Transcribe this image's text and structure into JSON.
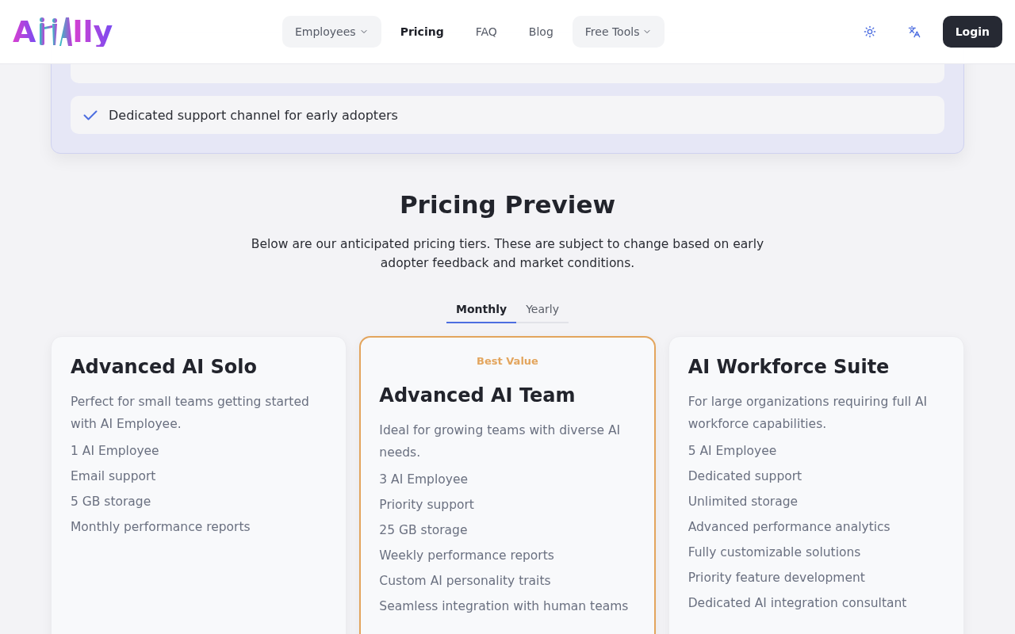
{
  "logo": {
    "lead": "A",
    "tail": "lly"
  },
  "nav": [
    {
      "label": "Employees",
      "dropdown": true,
      "selected": false
    },
    {
      "label": "Pricing",
      "dropdown": false,
      "selected": true
    },
    {
      "label": "FAQ",
      "dropdown": false,
      "selected": false
    },
    {
      "label": "Blog",
      "dropdown": false,
      "selected": false
    },
    {
      "label": "Free Tools",
      "dropdown": true,
      "selected": false
    }
  ],
  "login": "Login",
  "benefits": [
    "Dedicated support channel for early adopters"
  ],
  "pricing": {
    "title": "Pricing Preview",
    "intro": "Below are our anticipated pricing tiers. These are subject to change based on early adopter feedback and market conditions.",
    "tabs": [
      {
        "label": "Monthly",
        "selected": true
      },
      {
        "label": "Yearly",
        "selected": false
      }
    ],
    "plans": [
      {
        "name": "Advanced AI Solo",
        "highlighted": false,
        "description": "Perfect for small teams getting started with AI Employee.",
        "features": [
          "1 AI Employee",
          "Email support",
          "5 GB storage",
          "Monthly performance reports"
        ]
      },
      {
        "name": "Advanced AI Team",
        "highlighted": true,
        "badge": "Best Value",
        "description": "Ideal for growing teams with diverse AI needs.",
        "features": [
          "3 AI Employee",
          "Priority support",
          "25 GB storage",
          "Weekly performance reports",
          "Custom AI personality traits",
          "Seamless integration with human teams"
        ]
      },
      {
        "name": "AI Workforce Suite",
        "highlighted": false,
        "description": "For large organizations requiring full AI workforce capabilities.",
        "features": [
          "5 AI Employee",
          "Dedicated support",
          "Unlimited storage",
          "Advanced performance analytics",
          "Fully customizable solutions",
          "Priority feature development",
          "Dedicated AI integration consultant"
        ]
      }
    ]
  }
}
